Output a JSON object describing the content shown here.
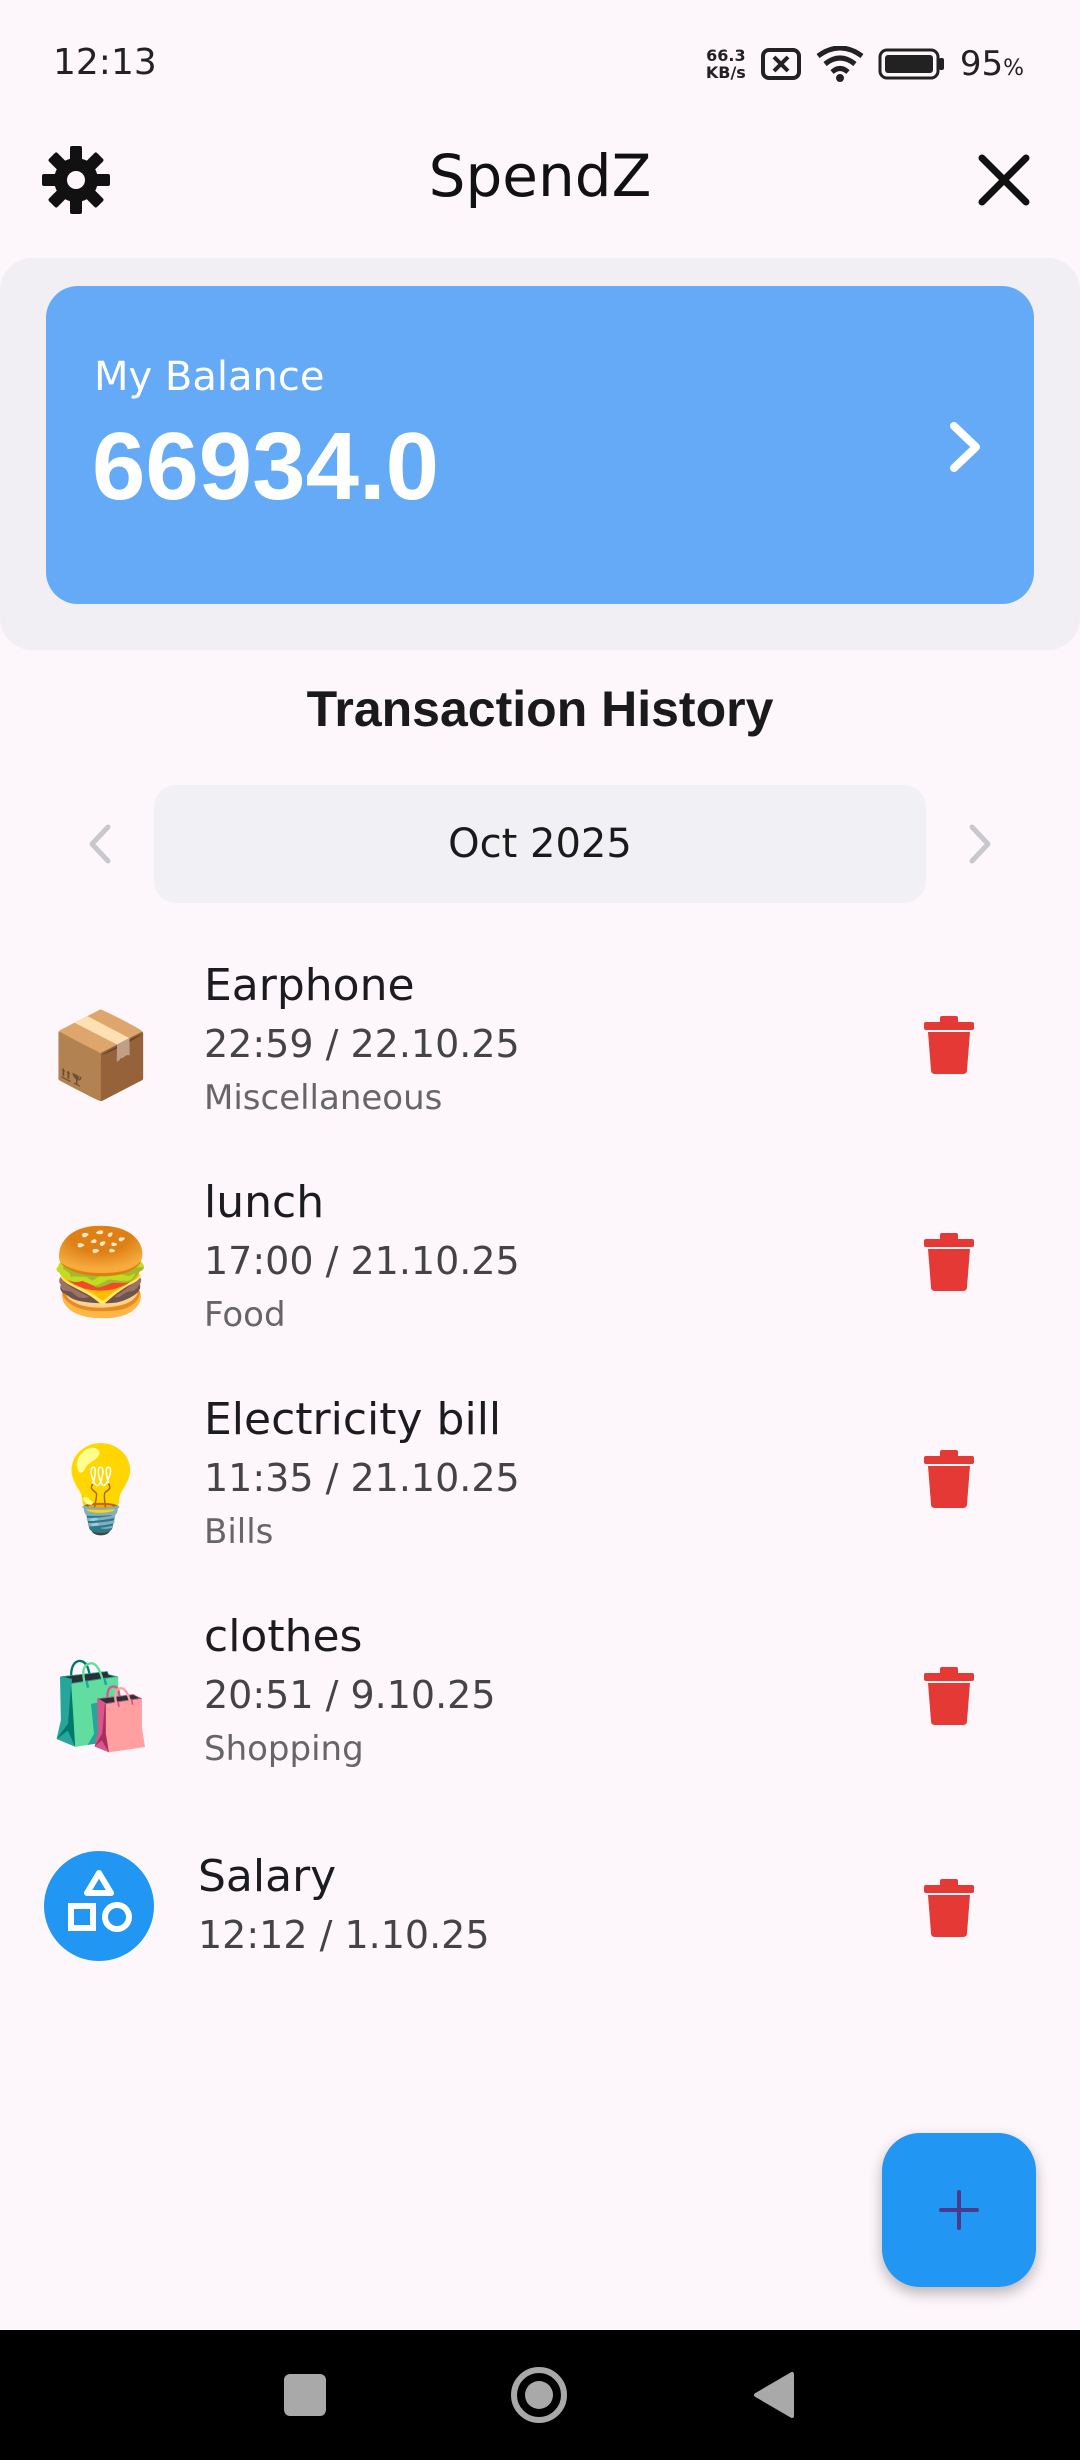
{
  "status_bar": {
    "time": "12:13",
    "net_speed_value": "66.3",
    "net_speed_unit": "KB/s",
    "battery_percent": "95",
    "battery_unit": "%"
  },
  "app_bar": {
    "title": "SpendZ",
    "settings_icon": "gear-icon",
    "close_icon": "close-icon"
  },
  "balance": {
    "label": "My Balance",
    "amount": "66934.0",
    "card_color": "#64aaf7"
  },
  "history": {
    "title": "Transaction History",
    "month": "Oct 2025"
  },
  "transactions": [
    {
      "icon": "📦",
      "title": "Earphone",
      "time": "22:59 / 22.10.25",
      "category": "Miscellaneous"
    },
    {
      "icon": "🍔",
      "title": "lunch",
      "time": "17:00 / 21.10.25",
      "category": "Food"
    },
    {
      "icon": "💡",
      "title": "Electricity bill",
      "time": "11:35 / 21.10.25",
      "category": "Bills"
    },
    {
      "icon": "🛍️",
      "title": "clothes",
      "time": "20:51 / 9.10.25",
      "category": "Shopping"
    },
    {
      "icon": "shapes-icon",
      "title": "Salary",
      "time": "12:12 / 1.10.25",
      "category": ""
    }
  ],
  "colors": {
    "delete": "#e53935",
    "fab": "#2196f3",
    "fab_plus": "#4a3a8c"
  }
}
